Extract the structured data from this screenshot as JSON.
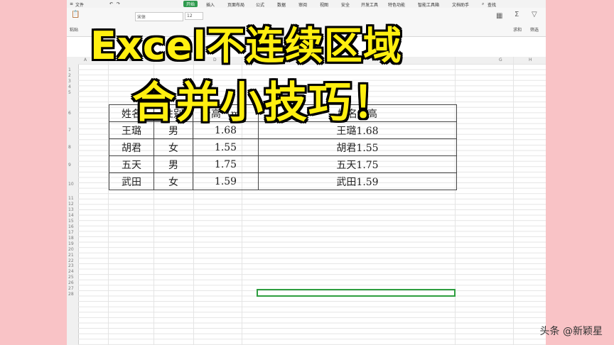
{
  "ribbon": {
    "tabs": [
      "文件",
      "开始",
      "插入",
      "页面布局",
      "公式",
      "数据",
      "审阅",
      "视图",
      "安全",
      "开发工具",
      "特色功能",
      "智能工具箱",
      "文档助手",
      "查找"
    ],
    "active_tab": "开始",
    "font_name": "宋体",
    "font_size": "12",
    "paste_label": "粘贴",
    "sum_label": "求和",
    "filter_label": "筛选"
  },
  "grid": {
    "columns": [
      "A",
      "B",
      "C",
      "D",
      "E",
      "F",
      "G",
      "H"
    ],
    "rows": [
      "1",
      "2",
      "3",
      "4",
      "5",
      "6",
      "7",
      "8",
      "9",
      "10",
      "11",
      "12",
      "13",
      "14",
      "15",
      "16",
      "17",
      "18",
      "19",
      "20",
      "21",
      "22",
      "23",
      "24",
      "25",
      "26",
      "27",
      "28"
    ]
  },
  "table": {
    "header": [
      "姓名",
      "性别",
      "身高（m）",
      "姓名身高"
    ],
    "rows": [
      [
        "王璐",
        "男",
        "1.68",
        "王璐1.68"
      ],
      [
        "胡君",
        "女",
        "1.55",
        "胡君1.55"
      ],
      [
        "五天",
        "男",
        "1.75",
        "五天1.75"
      ],
      [
        "武田",
        "女",
        "1.59",
        "武田1.59"
      ]
    ]
  },
  "overlay": {
    "line1": "Excel不连续区域",
    "line2": "合并小技巧！"
  },
  "watermark": "头条 @新颖星"
}
